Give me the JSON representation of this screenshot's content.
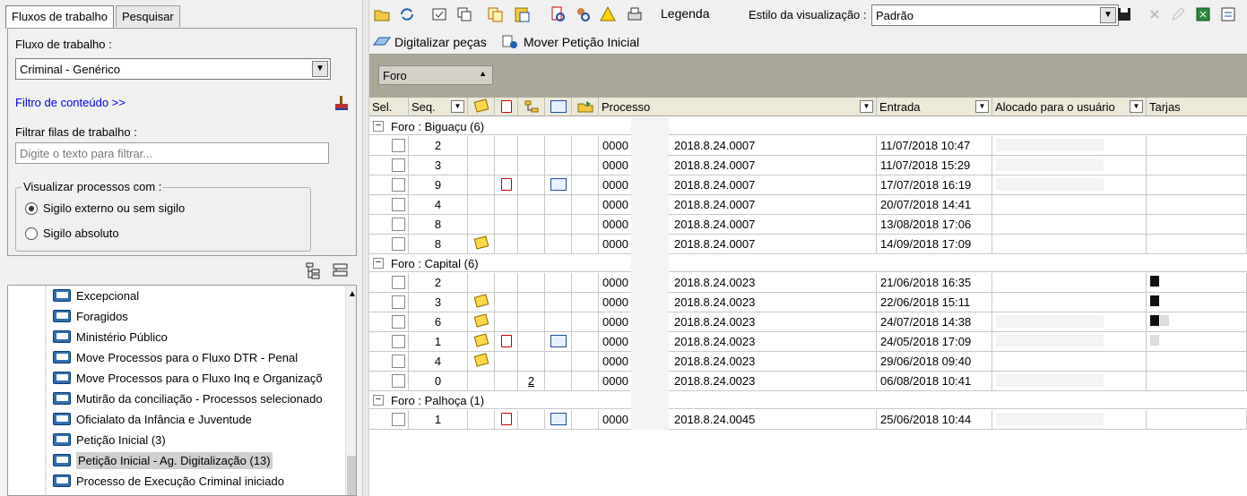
{
  "left": {
    "tabs": [
      "Fluxos de trabalho",
      "Pesquisar"
    ],
    "workflow_label": "Fluxo de trabalho :",
    "workflow_value": "Criminal - Genérico",
    "content_filter_link": "Filtro de conteúdo >>",
    "queue_filter_label": "Filtrar filas de trabalho :",
    "queue_filter_placeholder": "Digite o texto para filtrar...",
    "visualize_group_label": "Visualizar processos com :",
    "radio_options": [
      {
        "label": "Sigilo externo ou sem sigilo",
        "selected": true
      },
      {
        "label": "Sigilo absoluto",
        "selected": false
      }
    ],
    "tree_items": [
      "Excepcional",
      "Foragidos",
      "Ministério Público",
      "Move Processos para o Fluxo DTR - Penal",
      "Move Processos para o Fluxo Inq e Organizaçõ",
      "Mutirão da conciliação - Processos selecionado",
      "Oficialato da Infância e Juventude",
      "Petição Inicial (3)",
      "Petição Inicial - Ag. Digitalização (13)",
      "Processo de Execução Criminal iniciado"
    ],
    "selected_tree_item": "Petição Inicial - Ag. Digitalização (13)"
  },
  "toolbar": {
    "legend_label": "Legenda",
    "view_style_label": "Estilo da visualização :",
    "view_style_value": "Padrão",
    "action1": "Digitalizar peças",
    "action2": "Mover Petição Inicial"
  },
  "grid": {
    "group_by_chip": "Foro",
    "columns": [
      "Sel.",
      "Seq.",
      "Processo",
      "Entrada",
      "Alocado para o usuário",
      "Tarjas"
    ],
    "groups": [
      {
        "title": "Foro : Biguaçu  (6)",
        "rows": [
          {
            "seq": "2",
            "note": false,
            "red": false,
            "num": "",
            "blue": false,
            "proc": "0000",
            "ref": "2018.8.24.0007",
            "entrada": "11/07/2018 10:47",
            "user": true,
            "tarjas": []
          },
          {
            "seq": "3",
            "note": false,
            "red": false,
            "num": "",
            "blue": false,
            "proc": "0000",
            "ref": "2018.8.24.0007",
            "entrada": "11/07/2018 15:29",
            "user": true,
            "tarjas": []
          },
          {
            "seq": "9",
            "note": false,
            "red": true,
            "num": "",
            "blue": true,
            "proc": "0000",
            "ref": "2018.8.24.0007",
            "entrada": "17/07/2018 16:19",
            "user": true,
            "tarjas": []
          },
          {
            "seq": "4",
            "note": false,
            "red": false,
            "num": "",
            "blue": false,
            "proc": "0000",
            "ref": "2018.8.24.0007",
            "entrada": "20/07/2018 14:41",
            "user": false,
            "tarjas": []
          },
          {
            "seq": "8",
            "note": false,
            "red": false,
            "num": "",
            "blue": false,
            "proc": "0000",
            "ref": "2018.8.24.0007",
            "entrada": "13/08/2018 17:06",
            "user": false,
            "tarjas": []
          },
          {
            "seq": "8",
            "note": true,
            "red": false,
            "num": "",
            "blue": false,
            "proc": "0000",
            "ref": "2018.8.24.0007",
            "entrada": "14/09/2018 17:09",
            "user": false,
            "tarjas": []
          }
        ]
      },
      {
        "title": "Foro : Capital  (6)",
        "rows": [
          {
            "seq": "2",
            "note": false,
            "red": false,
            "num": "",
            "blue": false,
            "proc": "0000",
            "ref": "2018.8.24.0023",
            "entrada": "21/06/2018 16:35",
            "user": false,
            "tarjas": [
              "b"
            ]
          },
          {
            "seq": "3",
            "note": true,
            "red": false,
            "num": "",
            "blue": false,
            "proc": "0000",
            "ref": "2018.8.24.0023",
            "entrada": "22/06/2018 15:11",
            "user": false,
            "tarjas": [
              "b"
            ]
          },
          {
            "seq": "6",
            "note": true,
            "red": false,
            "num": "",
            "blue": false,
            "proc": "0000",
            "ref": "2018.8.24.0023",
            "entrada": "24/07/2018 14:38",
            "user": true,
            "tarjas": [
              "b",
              "g"
            ]
          },
          {
            "seq": "1",
            "note": true,
            "red": true,
            "num": "",
            "blue": true,
            "proc": "0000",
            "ref": "2018.8.24.0023",
            "entrada": "24/05/2018 17:09",
            "user": true,
            "tarjas": [
              "g"
            ]
          },
          {
            "seq": "4",
            "note": true,
            "red": false,
            "num": "",
            "blue": false,
            "proc": "0000",
            "ref": "2018.8.24.0023",
            "entrada": "29/06/2018 09:40",
            "user": false,
            "tarjas": []
          },
          {
            "seq": "0",
            "note": false,
            "red": false,
            "num": "2",
            "blue": false,
            "proc": "0000",
            "ref": "2018.8.24.0023",
            "entrada": "06/08/2018 10:41",
            "user": true,
            "tarjas": []
          }
        ]
      },
      {
        "title": "Foro : Palhoça  (1)",
        "rows": [
          {
            "seq": "1",
            "note": false,
            "red": true,
            "num": "",
            "blue": true,
            "proc": "0000",
            "ref": "2018.8.24.0045",
            "entrada": "25/06/2018 10:44",
            "user": true,
            "tarjas": []
          }
        ]
      }
    ]
  }
}
